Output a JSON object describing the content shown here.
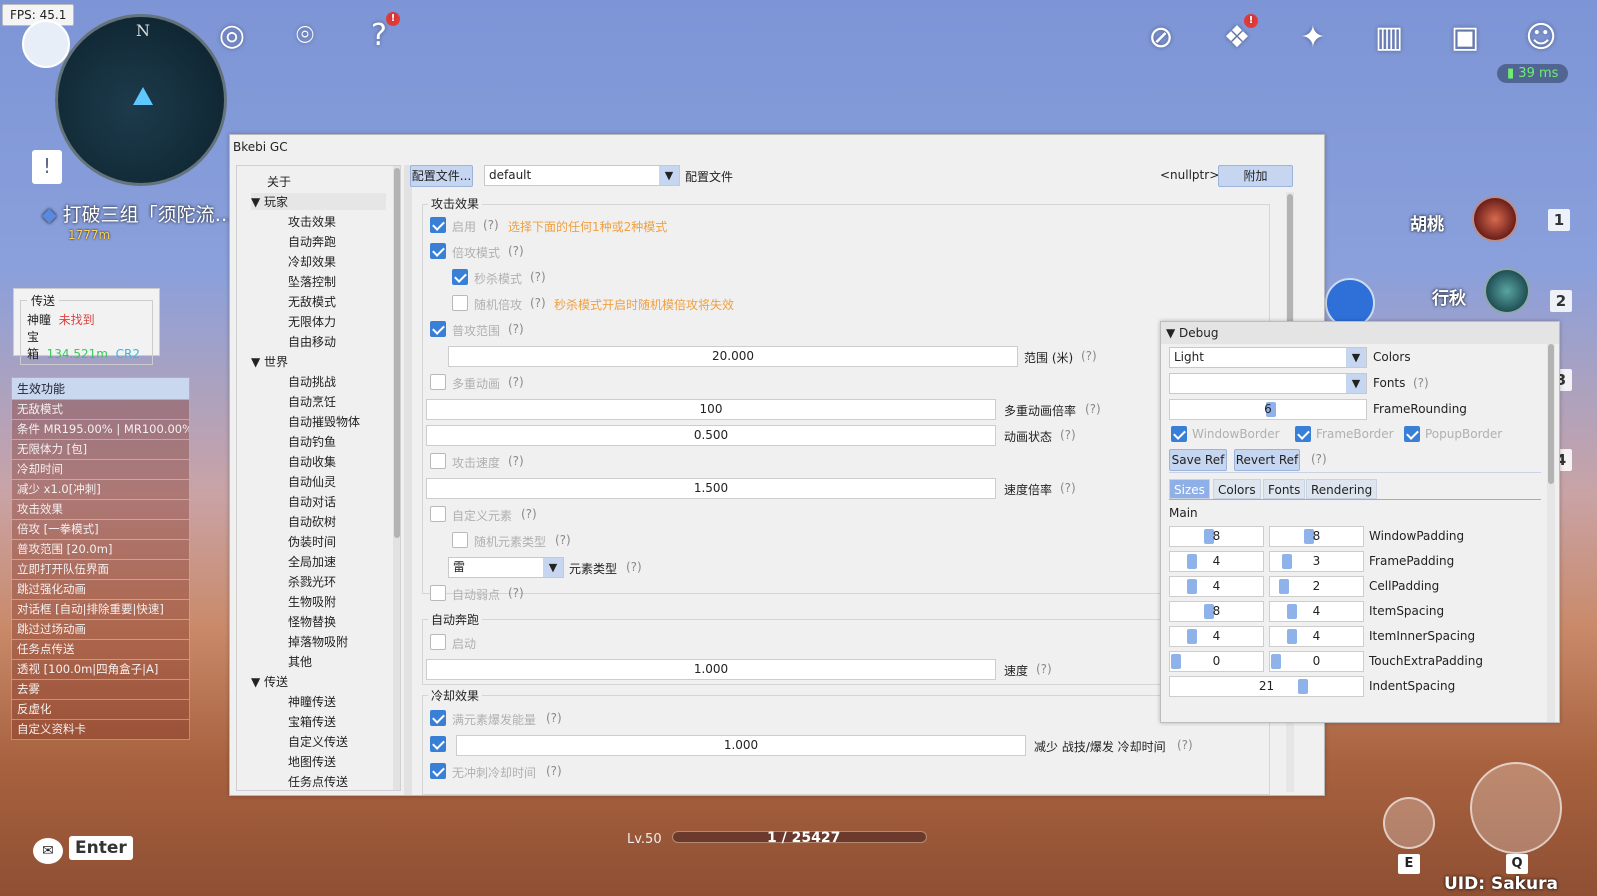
{
  "fps": "FPS: 45.1",
  "minimap": {
    "north": "N"
  },
  "quest": {
    "title": "打破三组「须陀流…",
    "distance": "1777m"
  },
  "ping": "39 ms",
  "teleport_box": {
    "legend": "传送",
    "rows": [
      {
        "label": "神瞳",
        "value": "未找到"
      },
      {
        "label": "宝箱",
        "value": "134.521m",
        "extra": "CR2"
      }
    ]
  },
  "features": {
    "header": "生效功能",
    "rows": [
      "无敌模式",
      "条件 MR195.00% | MR100.00%",
      "无限体力 [包]",
      "冷却时间",
      "减少 x1.0[冲刺]",
      "攻击效果",
      "倍攻 [一拳模式]",
      "普攻范围 [20.0m]",
      "立即打开队伍界面",
      "跳过强化动画",
      "对话框 [自动|排除重要|快速]",
      "跳过过场动画",
      "任务点传送",
      "透视 [100.0m|四角盒子|A]",
      "去雾",
      "反虚化",
      "自定义资料卡"
    ]
  },
  "party": [
    {
      "name": "胡桃",
      "num": "1"
    },
    {
      "name": "行秋",
      "num": "2"
    },
    {
      "num": "3"
    },
    {
      "num": "4"
    }
  ],
  "bottom": {
    "chat_key": "Enter",
    "level": "Lv.50",
    "xp": "1 / 25427",
    "uid": "UID: Sakura",
    "skill_e": "E",
    "skill_q": "Q"
  },
  "window": {
    "title": "Bkebi GC",
    "tree": [
      {
        "label": "关于",
        "indent": 1
      },
      {
        "label": "▼  玩家",
        "indent": 0
      },
      {
        "label": "攻击效果",
        "indent": 2
      },
      {
        "label": "自动奔跑",
        "indent": 2
      },
      {
        "label": "冷却效果",
        "indent": 2
      },
      {
        "label": "坠落控制",
        "indent": 2
      },
      {
        "label": "无敌模式",
        "indent": 2
      },
      {
        "label": "无限体力",
        "indent": 2
      },
      {
        "label": "自由移动",
        "indent": 2
      },
      {
        "label": "▼  世界",
        "indent": 0
      },
      {
        "label": "自动挑战",
        "indent": 2
      },
      {
        "label": "自动烹饪",
        "indent": 2
      },
      {
        "label": "自动摧毁物体",
        "indent": 2
      },
      {
        "label": "自动钓鱼",
        "indent": 2
      },
      {
        "label": "自动收集",
        "indent": 2
      },
      {
        "label": "自动仙灵",
        "indent": 2
      },
      {
        "label": "自动对话",
        "indent": 2
      },
      {
        "label": "自动砍树",
        "indent": 2
      },
      {
        "label": "伪装时间",
        "indent": 2
      },
      {
        "label": "全局加速",
        "indent": 2
      },
      {
        "label": "杀戮光环",
        "indent": 2
      },
      {
        "label": "生物吸附",
        "indent": 2
      },
      {
        "label": "怪物替换",
        "indent": 2
      },
      {
        "label": "掉落物吸附",
        "indent": 2
      },
      {
        "label": "其他",
        "indent": 2
      },
      {
        "label": "▼  传送",
        "indent": 0
      },
      {
        "label": "神瞳传送",
        "indent": 2
      },
      {
        "label": "宝箱传送",
        "indent": 2
      },
      {
        "label": "自定义传送",
        "indent": 2
      },
      {
        "label": "地图传送",
        "indent": 2
      },
      {
        "label": "任务点传送",
        "indent": 2
      }
    ],
    "toolbar": {
      "config_btn": "配置文件...",
      "profile": "default",
      "profile_label": "配置文件",
      "nullptr": "<nullptr>",
      "attach_btn": "附加"
    },
    "attack": {
      "title": "攻击效果",
      "enable": "启用",
      "enable_hint": "选择下面的任何1种或2种模式",
      "multiplier": "倍攻模式",
      "one_punch": "秒杀模式",
      "random_mult": "随机倍攻",
      "random_hint": "秒杀模式开启时随机模倍攻将失效",
      "range": "普攻范围",
      "range_value": "20.000",
      "range_label": "范围 (米)",
      "multi_anim": "多重动画",
      "anim_mult_value": "100",
      "anim_mult_label": "多重动画倍率",
      "anim_state_value": "0.500",
      "anim_state_label": "动画状态",
      "atk_speed": "攻击速度",
      "speed_value": "1.500",
      "speed_label": "速度倍率",
      "custom_elem": "自定义元素",
      "random_elem": "随机元素类型",
      "elem_value": "雷",
      "elem_label": "元素类型",
      "auto_weak": "自动弱点",
      "q": "(?)"
    },
    "autorun": {
      "title": "自动奔跑",
      "enable": "启动",
      "speed_value": "1.000",
      "speed_label": "速度"
    },
    "cooldown": {
      "title": "冷却效果",
      "burst": "满元素爆发能量",
      "reduce_value": "1.000",
      "reduce_label": "减少 战技/爆发 冷却时间",
      "no_dash": "无冲刺冷却时间"
    }
  },
  "debug": {
    "title": "Debug",
    "colors_value": "Light",
    "colors_label": "Colors",
    "fonts_value": "",
    "fonts_label": "Fonts",
    "frame_rounding": "6",
    "frame_rounding_label": "FrameRounding",
    "window_border": "WindowBorder",
    "frame_border": "FrameBorder",
    "popup_border": "PopupBorder",
    "save_ref": "Save Ref",
    "revert_ref": "Revert Ref",
    "q": "(?)",
    "tabs": [
      "Sizes",
      "Colors",
      "Fonts",
      "Rendering"
    ],
    "main": "Main",
    "rows": [
      {
        "a": "8",
        "b": "8",
        "label": "WindowPadding"
      },
      {
        "a": "4",
        "b": "3",
        "label": "FramePadding"
      },
      {
        "a": "4",
        "b": "2",
        "label": "CellPadding"
      },
      {
        "a": "8",
        "b": "4",
        "label": "ItemSpacing"
      },
      {
        "a": "4",
        "b": "4",
        "label": "ItemInnerSpacing"
      },
      {
        "a": "0",
        "b": "0",
        "label": "TouchExtraPadding"
      },
      {
        "a": "21",
        "label": "IndentSpacing"
      }
    ]
  }
}
